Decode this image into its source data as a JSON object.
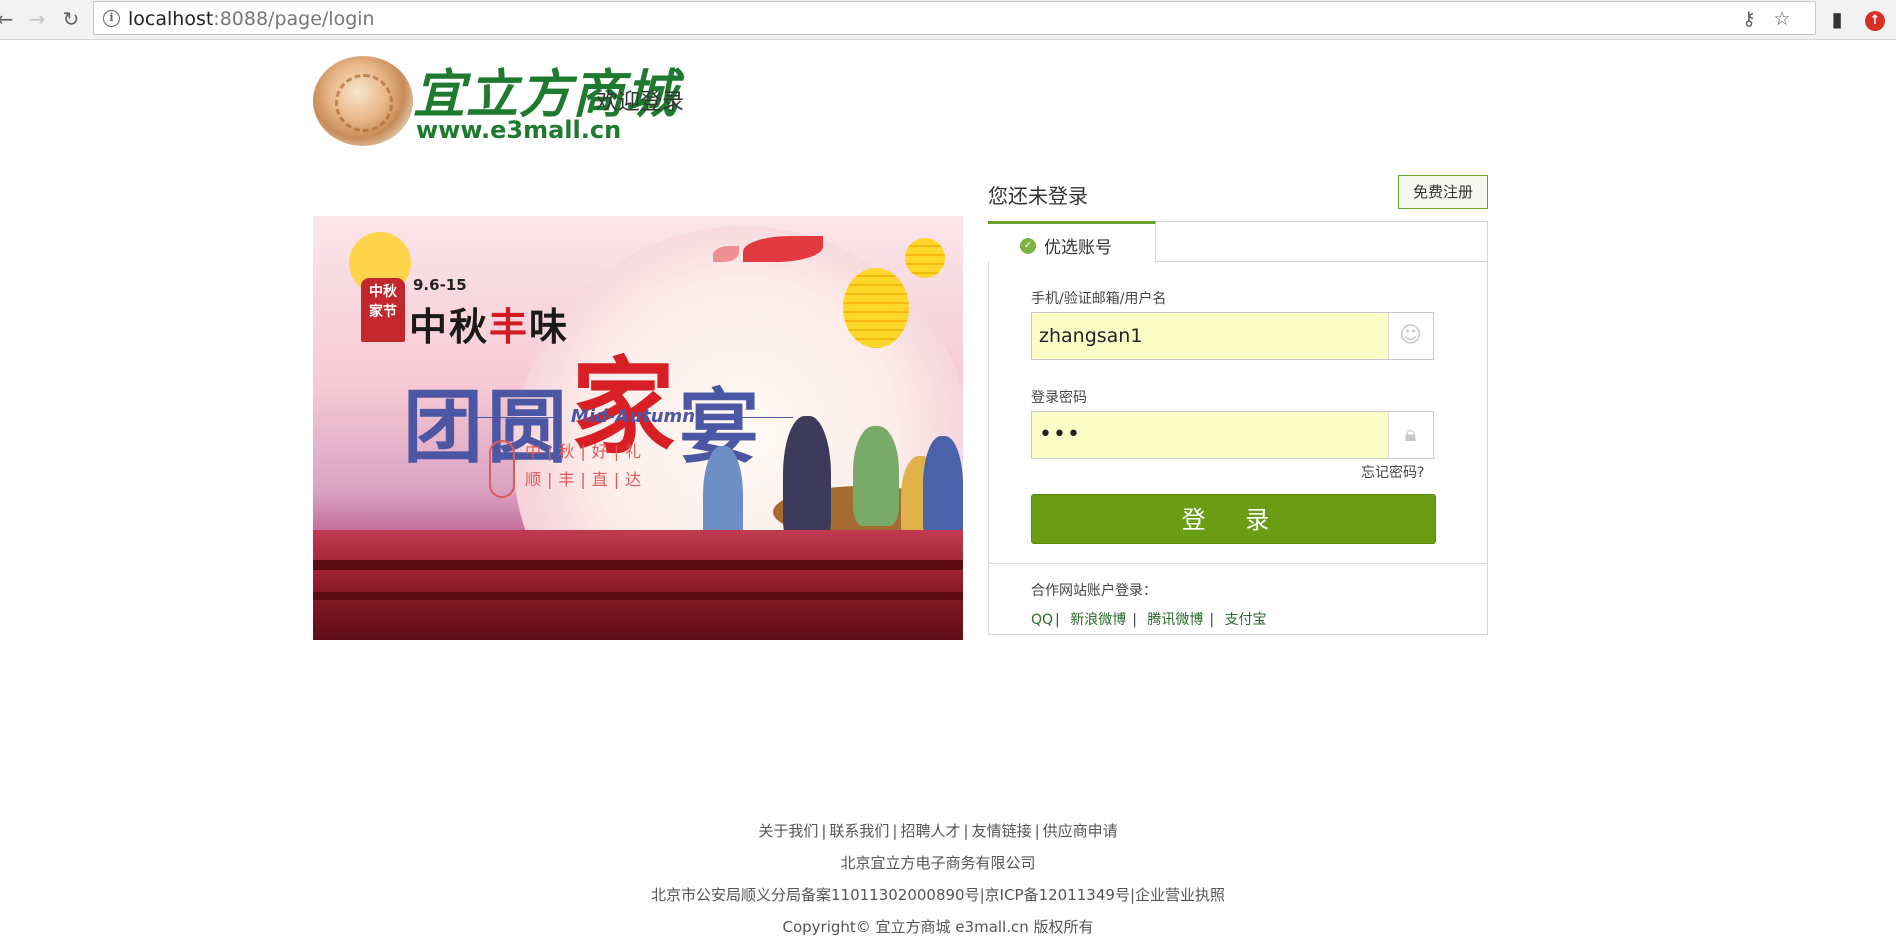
{
  "browser": {
    "url_host": "localhost",
    "url_rest": ":8088/page/login"
  },
  "header": {
    "logo_cn": "宜立方商城",
    "logo_en": "www.e3mall.cn",
    "welcome": "欢迎登录"
  },
  "banner": {
    "stamp": "中秋\n家节",
    "date": "9.6-15",
    "title_black1": "中秋",
    "title_red": "丰",
    "title_black2": "味",
    "main_a": "团圆",
    "main_big": "家",
    "main_b": "宴",
    "mid": "Mid-Autumn",
    "slogan_line1": "中|秋|好|礼",
    "slogan_line2": "顺|丰|直|达"
  },
  "login": {
    "not_logged": "您还未登录",
    "register": "免费注册",
    "tab_label": "优选账号",
    "username_label": "手机/验证邮箱/用户名",
    "username_value": "zhangsan1",
    "password_label": "登录密码",
    "password_value": "•••",
    "forgot": "忘记密码?",
    "submit": "登 录",
    "partner_label": "合作网站账户登录：",
    "partners": [
      "QQ",
      "新浪微博",
      "腾讯微博",
      "支付宝"
    ]
  },
  "footer": {
    "links": [
      "关于我们",
      "联系我们",
      "招聘人才",
      "友情链接",
      "供应商申请"
    ],
    "company": "北京宜立方电子商务有限公司",
    "icp": "北京市公安局顺义分局备案11011302000890号|京ICP备12011349号|企业营业执照",
    "copyright": "Copyright© 宜立方商城 e3mall.cn 版权所有"
  }
}
